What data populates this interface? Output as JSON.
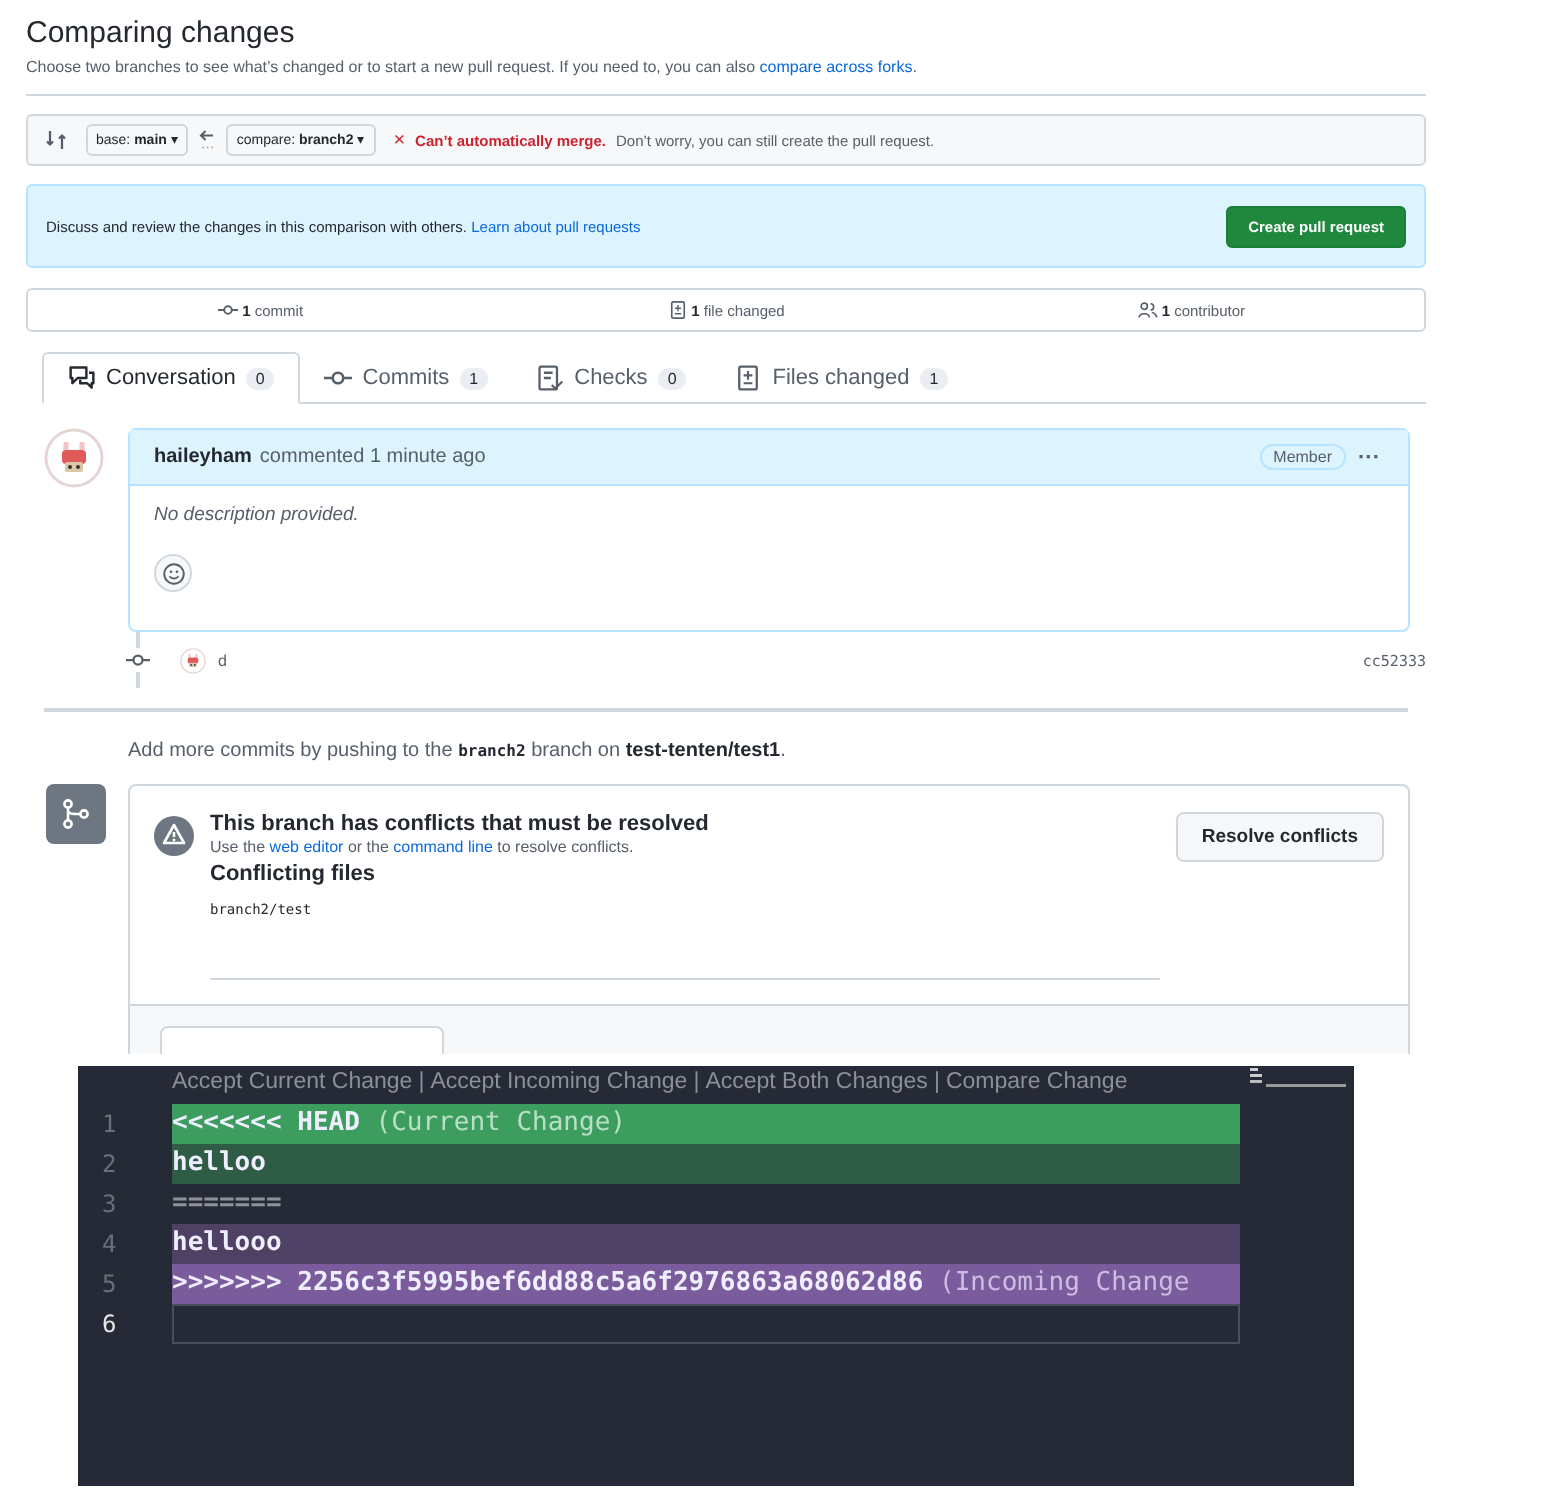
{
  "header": {
    "title": "Comparing changes",
    "subtitle": {
      "text": "Choose two branches to see what’s changed or to start a new pull request. If you need to, you can also ",
      "link": "compare across forks",
      "after": "."
    }
  },
  "range": {
    "base": "base: **main**",
    "compare": "compare: **branch2**",
    "caret": "▾",
    "status_mark": "×",
    "status": "Can’t automatically merge.",
    "status_note": "Don’t worry, you can still create the pull request."
  },
  "flash": {
    "text": "Discuss and review the changes in this comparison with others. ",
    "link": "Learn about pull requests",
    "button": "Create pull request"
  },
  "stats": [
    {
      "count": "1",
      "label": "commit"
    },
    {
      "count": "1",
      "label": "file changed"
    },
    {
      "count": "1",
      "label": "contributor"
    }
  ],
  "tabs": [
    {
      "label": "Conversation",
      "count": "0",
      "selected": true
    },
    {
      "label": "Commits",
      "count": "1",
      "selected": false
    },
    {
      "label": "Checks",
      "count": "0",
      "selected": false
    },
    {
      "label": "Files changed",
      "count": "1",
      "selected": false
    }
  ],
  "comment": {
    "author": "haileyham",
    "action": "commented 1 minute ago",
    "role": "Member",
    "menu": "···",
    "body": "No description provided."
  },
  "commit": {
    "message": "d",
    "sha": "cc52333"
  },
  "push_hint": "Add more commits by pushing to the **branch2** branch on **test-tenten/test1**.",
  "merge": {
    "title": "This branch has conflicts that must be resolved",
    "note": {
      "before": "Use the ",
      "link1": "web editor",
      "middle": " or the ",
      "link2": "command line",
      "after": " to resolve conflicts."
    },
    "button": "Resolve conflicts",
    "files_title": "Conflicting files",
    "files": [
      "branch2/test"
    ]
  },
  "editor": {
    "codelens": [
      "Accept Current Change",
      "Accept Incoming Change",
      "Accept Both Changes",
      "Compare Change"
    ],
    "separator": "|",
    "lines": [
      {
        "number": "1",
        "kind": "current-marker",
        "text": "<<<<<<< HEAD",
        "note": "(Current Change)",
        "active": false
      },
      {
        "number": "2",
        "kind": "current",
        "text": "helloo",
        "active": false
      },
      {
        "number": "3",
        "kind": "separator",
        "text": "=======",
        "active": false
      },
      {
        "number": "4",
        "kind": "incoming",
        "text": "hellooo",
        "active": false
      },
      {
        "number": "5",
        "kind": "incoming-marker",
        "text": ">>>>>>> 2256c3f5995bef6dd88c5a6f2976863a68062d86",
        "note": "(Incoming Change",
        "active": false
      },
      {
        "number": "6",
        "kind": "blank",
        "active": true
      }
    ]
  }
}
